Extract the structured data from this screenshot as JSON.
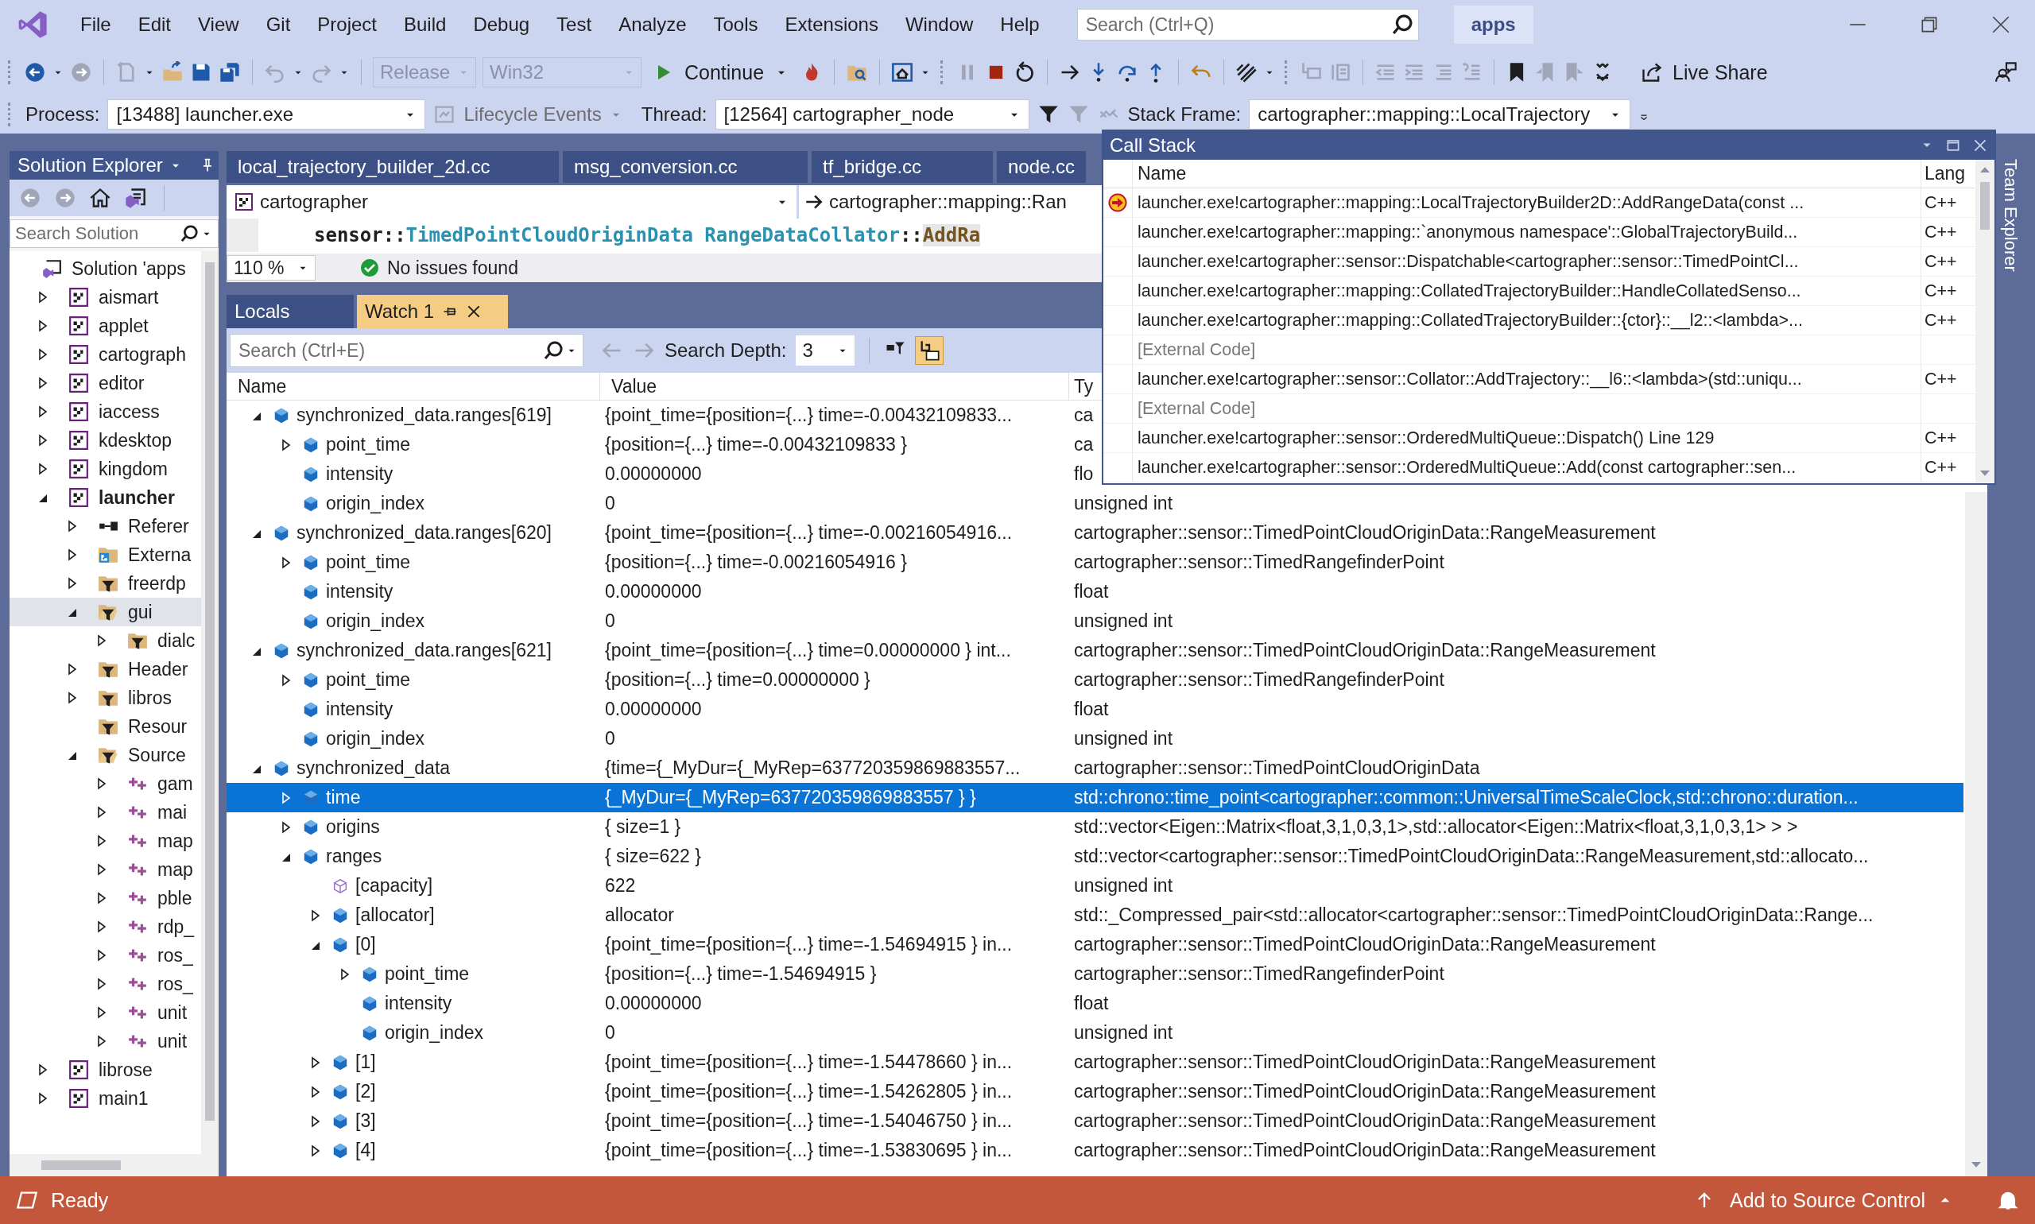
{
  "menu_bar": {
    "items": [
      "File",
      "Edit",
      "View",
      "Git",
      "Project",
      "Build",
      "Debug",
      "Test",
      "Analyze",
      "Tools",
      "Extensions",
      "Window",
      "Help"
    ],
    "search": {
      "placeholder": "Search (Ctrl+Q)"
    },
    "solution_name": "apps"
  },
  "toolbar": {
    "configuration": {
      "value": "Release",
      "disabled": true
    },
    "platform": {
      "value": "Win32",
      "disabled": true
    },
    "continue_button": "Continue",
    "live_share": "Live Share"
  },
  "debug_location": {
    "process_label": "Process:",
    "process": "[13488] launcher.exe",
    "lifecycle_events": "Lifecycle Events",
    "thread_label": "Thread:",
    "thread": "[12564] cartographer_node",
    "stack_frame_label": "Stack Frame:",
    "stack_frame": "cartographer::mapping::LocalTrajectory"
  },
  "solution_explorer": {
    "title": "Solution Explorer",
    "search": {
      "placeholder": "Search Solution"
    },
    "tree": [
      {
        "label": "Solution 'apps",
        "kind": "solution",
        "selected": false,
        "children": [
          {
            "label": "aismart",
            "kind": "project",
            "expanded": false,
            "selected": false,
            "startup": false
          },
          {
            "label": "applet",
            "kind": "project",
            "expanded": false,
            "selected": false,
            "startup": false
          },
          {
            "label": "cartograph",
            "kind": "project",
            "expanded": false,
            "selected": false,
            "startup": false
          },
          {
            "label": "editor",
            "kind": "project",
            "expanded": false,
            "selected": false,
            "startup": false
          },
          {
            "label": "iaccess",
            "kind": "project",
            "expanded": false,
            "selected": false,
            "startup": false
          },
          {
            "label": "kdesktop",
            "kind": "project",
            "expanded": false,
            "selected": false,
            "startup": false
          },
          {
            "label": "kingdom",
            "kind": "project",
            "expanded": false,
            "selected": false,
            "startup": false
          },
          {
            "label": "launcher",
            "kind": "project",
            "expanded": true,
            "selected": false,
            "startup": true,
            "children": [
              {
                "label": "Referer",
                "kind": "references",
                "expanded": false,
                "selected": false
              },
              {
                "label": "Externa",
                "kind": "external",
                "expanded": false,
                "selected": false
              },
              {
                "label": "freerdp",
                "kind": "filter",
                "expanded": false,
                "selected": false
              },
              {
                "label": "gui",
                "kind": "filter",
                "expanded": true,
                "selected": true,
                "children": [
                  {
                    "label": "dialc",
                    "kind": "filter",
                    "expanded": false,
                    "selected": false
                  }
                ]
              },
              {
                "label": "Header",
                "kind": "filter",
                "expanded": false,
                "selected": false
              },
              {
                "label": "libros",
                "kind": "filter",
                "expanded": false,
                "selected": false
              },
              {
                "label": "Resour",
                "kind": "filter",
                "selected": false
              },
              {
                "label": "Source",
                "kind": "filter",
                "expanded": true,
                "selected": false,
                "children": [
                  {
                    "label": "gam",
                    "kind": "file",
                    "expanded": false,
                    "selected": false
                  },
                  {
                    "label": "mai",
                    "kind": "file",
                    "expanded": false,
                    "selected": false
                  },
                  {
                    "label": "map",
                    "kind": "file",
                    "expanded": false,
                    "selected": false
                  },
                  {
                    "label": "map",
                    "kind": "file",
                    "expanded": false,
                    "selected": false
                  },
                  {
                    "label": "pble",
                    "kind": "file",
                    "expanded": false,
                    "selected": false
                  },
                  {
                    "label": "rdp_",
                    "kind": "file",
                    "expanded": false,
                    "selected": false
                  },
                  {
                    "label": "ros_",
                    "kind": "file",
                    "expanded": false,
                    "selected": false
                  },
                  {
                    "label": "ros_",
                    "kind": "file",
                    "expanded": false,
                    "selected": false
                  },
                  {
                    "label": "unit",
                    "kind": "file",
                    "expanded": false,
                    "selected": false
                  },
                  {
                    "label": "unit",
                    "kind": "file",
                    "expanded": false,
                    "selected": false
                  }
                ]
              }
            ]
          },
          {
            "label": "librose",
            "kind": "project",
            "expanded": false,
            "selected": false,
            "startup": false
          },
          {
            "label": "main1",
            "kind": "project",
            "expanded": false,
            "selected": false,
            "startup": false
          }
        ]
      }
    ]
  },
  "editor": {
    "tabs": [
      {
        "label": "local_trajectory_builder_2d.cc",
        "selected": false
      },
      {
        "label": "msg_conversion.cc",
        "selected": false
      },
      {
        "label": "tf_bridge.cc",
        "selected": false
      },
      {
        "label": "node.cc",
        "selected": false
      }
    ],
    "project": "cartographer",
    "scope": "cartographer::mapping::Ran",
    "code_line": [
      {
        "text": "sensor::",
        "kind": "plain"
      },
      {
        "text": "TimedPointCloudOriginData RangeDataCollator",
        "kind": "type"
      },
      {
        "text": "::",
        "kind": "plain"
      },
      {
        "text": "AddRa",
        "kind": "function"
      }
    ],
    "zoom": "110 %",
    "status": "No issues found"
  },
  "watch_panel": {
    "tabs": [
      {
        "label": "Locals",
        "selected": false
      },
      {
        "label": "Watch 1",
        "selected": true
      }
    ],
    "search": {
      "placeholder": "Search (Ctrl+E)"
    },
    "search_depth_label": "Search Depth:",
    "search_depth": "3",
    "columns": [
      "Name",
      "Value",
      "Ty"
    ],
    "rows": [
      {
        "name": "synchronized_data.ranges[619]",
        "value": "{point_time={position={...} time=-0.00432109833...",
        "type": "ca",
        "kind": "field",
        "expanded": true,
        "selected": false,
        "children": [
          {
            "name": "point_time",
            "value": "{position={...} time=-0.00432109833 }",
            "type": "ca",
            "kind": "field",
            "expanded": false,
            "selected": false
          },
          {
            "name": "intensity",
            "value": "0.00000000",
            "type": "flo",
            "kind": "field",
            "selected": false
          },
          {
            "name": "origin_index",
            "value": "0",
            "type": "unsigned int",
            "kind": "field",
            "selected": false
          }
        ]
      },
      {
        "name": "synchronized_data.ranges[620]",
        "value": "{point_time={position={...} time=-0.00216054916...",
        "type": "cartographer::sensor::TimedPointCloudOriginData::RangeMeasurement",
        "kind": "field",
        "expanded": true,
        "selected": false,
        "children": [
          {
            "name": "point_time",
            "value": "{position={...} time=-0.00216054916 }",
            "type": "cartographer::sensor::TimedRangefinderPoint",
            "kind": "field",
            "expanded": false,
            "selected": false
          },
          {
            "name": "intensity",
            "value": "0.00000000",
            "type": "float",
            "kind": "field",
            "selected": false
          },
          {
            "name": "origin_index",
            "value": "0",
            "type": "unsigned int",
            "kind": "field",
            "selected": false
          }
        ]
      },
      {
        "name": "synchronized_data.ranges[621]",
        "value": "{point_time={position={...} time=0.00000000 } int...",
        "type": "cartographer::sensor::TimedPointCloudOriginData::RangeMeasurement",
        "kind": "field",
        "expanded": true,
        "selected": false,
        "children": [
          {
            "name": "point_time",
            "value": "{position={...} time=0.00000000 }",
            "type": "cartographer::sensor::TimedRangefinderPoint",
            "kind": "field",
            "expanded": false,
            "selected": false
          },
          {
            "name": "intensity",
            "value": "0.00000000",
            "type": "float",
            "kind": "field",
            "selected": false
          },
          {
            "name": "origin_index",
            "value": "0",
            "type": "unsigned int",
            "kind": "field",
            "selected": false
          }
        ]
      },
      {
        "name": "synchronized_data",
        "value": "{time={_MyDur={_MyRep=637720359869883557...",
        "type": "cartographer::sensor::TimedPointCloudOriginData",
        "kind": "field",
        "expanded": true,
        "selected": false,
        "children": [
          {
            "name": "time",
            "value": "{_MyDur={_MyRep=637720359869883557 } }",
            "type": "std::chrono::time_point<cartographer::common::UniversalTimeScaleClock,std::chrono::duration...",
            "kind": "field",
            "expanded": false,
            "selected": true
          },
          {
            "name": "origins",
            "value": "{ size=1 }",
            "type": "std::vector<Eigen::Matrix<float,3,1,0,3,1>,std::allocator<Eigen::Matrix<float,3,1,0,3,1> > >",
            "kind": "field",
            "expanded": false,
            "selected": false
          },
          {
            "name": "ranges",
            "value": "{ size=622 }",
            "type": "std::vector<cartographer::sensor::TimedPointCloudOriginData::RangeMeasurement,std::allocato...",
            "kind": "field",
            "expanded": true,
            "selected": false,
            "children": [
              {
                "name": "[capacity]",
                "value": "622",
                "type": "unsigned int",
                "kind": "raw",
                "selected": false
              },
              {
                "name": "[allocator]",
                "value": "allocator",
                "type": "std::_Compressed_pair<std::allocator<cartographer::sensor::TimedPointCloudOriginData::Range...",
                "kind": "field",
                "expanded": false,
                "selected": false
              },
              {
                "name": "[0]",
                "value": "{point_time={position={...} time=-1.54694915 } in...",
                "type": "cartographer::sensor::TimedPointCloudOriginData::RangeMeasurement",
                "kind": "field",
                "expanded": true,
                "selected": false,
                "children": [
                  {
                    "name": "point_time",
                    "value": "{position={...} time=-1.54694915 }",
                    "type": "cartographer::sensor::TimedRangefinderPoint",
                    "kind": "field",
                    "expanded": false,
                    "selected": false
                  },
                  {
                    "name": "intensity",
                    "value": "0.00000000",
                    "type": "float",
                    "kind": "field",
                    "selected": false
                  },
                  {
                    "name": "origin_index",
                    "value": "0",
                    "type": "unsigned int",
                    "kind": "field",
                    "selected": false
                  }
                ]
              },
              {
                "name": "[1]",
                "value": "{point_time={position={...} time=-1.54478660 } in...",
                "type": "cartographer::sensor::TimedPointCloudOriginData::RangeMeasurement",
                "kind": "field",
                "expanded": false,
                "selected": false
              },
              {
                "name": "[2]",
                "value": "{point_time={position={...} time=-1.54262805 } in...",
                "type": "cartographer::sensor::TimedPointCloudOriginData::RangeMeasurement",
                "kind": "field",
                "expanded": false,
                "selected": false
              },
              {
                "name": "[3]",
                "value": "{point_time={position={...} time=-1.54046750 } in...",
                "type": "cartographer::sensor::TimedPointCloudOriginData::RangeMeasurement",
                "kind": "field",
                "expanded": false,
                "selected": false
              },
              {
                "name": "[4]",
                "value": "{point_time={position={...} time=-1.53830695 } in...",
                "type": "cartographer::sensor::TimedPointCloudOriginData::RangeMeasurement",
                "kind": "field",
                "expanded": false,
                "selected": false
              }
            ]
          }
        ]
      }
    ]
  },
  "call_stack": {
    "title": "Call Stack",
    "columns": [
      "Name",
      "Lang"
    ],
    "frames": [
      {
        "kind": "current",
        "name": "launcher.exe!cartographer::mapping::LocalTrajectoryBuilder2D::AddRangeData(const ...",
        "lang": "C++"
      },
      {
        "kind": "normal",
        "name": "launcher.exe!cartographer::mapping::`anonymous namespace'::GlobalTrajectoryBuild...",
        "lang": "C++"
      },
      {
        "kind": "normal",
        "name": "launcher.exe!cartographer::sensor::Dispatchable<cartographer::sensor::TimedPointCl...",
        "lang": "C++"
      },
      {
        "kind": "normal",
        "name": "launcher.exe!cartographer::mapping::CollatedTrajectoryBuilder::HandleCollatedSenso...",
        "lang": "C++"
      },
      {
        "kind": "normal",
        "name": "launcher.exe!cartographer::mapping::CollatedTrajectoryBuilder::{ctor}::__l2::<lambda>...",
        "lang": "C++"
      },
      {
        "kind": "external",
        "name": "[External Code]"
      },
      {
        "kind": "normal",
        "name": "launcher.exe!cartographer::sensor::Collator::AddTrajectory::__l6::<lambda>(std::uniqu...",
        "lang": "C++"
      },
      {
        "kind": "external",
        "name": "[External Code]"
      },
      {
        "kind": "normal",
        "name": "launcher.exe!cartographer::sensor::OrderedMultiQueue::Dispatch() Line 129",
        "lang": "C++"
      },
      {
        "kind": "normal",
        "name": "launcher.exe!cartographer::sensor::OrderedMultiQueue::Add(const cartographer::sen...",
        "lang": "C++"
      }
    ]
  },
  "side_tab": "Team Explorer",
  "status_bar": {
    "text": "Ready",
    "source_control": "Add to Source Control"
  }
}
